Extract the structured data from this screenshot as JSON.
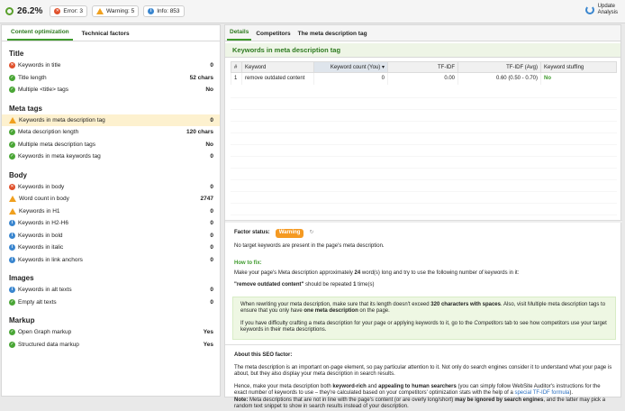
{
  "topbar": {
    "score": "26.2%",
    "error": "Error: 3",
    "warning": "Warning: 5",
    "info": "Info: 853",
    "update_line1": "Update",
    "update_line2": "Analysis"
  },
  "left": {
    "tabs": [
      "Content optimization",
      "Technical factors"
    ],
    "sections": [
      {
        "title": "Title",
        "items": [
          {
            "label": "Keywords in title",
            "value": "0",
            "status": "error"
          },
          {
            "label": "Title length",
            "value": "52 chars",
            "status": "ok"
          },
          {
            "label": "Multiple <title> tags",
            "value": "No",
            "status": "ok"
          }
        ]
      },
      {
        "title": "Meta tags",
        "items": [
          {
            "label": "Keywords in meta description tag",
            "value": "0",
            "status": "warning",
            "selected": true
          },
          {
            "label": "Meta description length",
            "value": "120 chars",
            "status": "ok"
          },
          {
            "label": "Multiple meta description tags",
            "value": "No",
            "status": "ok"
          },
          {
            "label": "Keywords in meta keywords tag",
            "value": "0",
            "status": "ok"
          }
        ]
      },
      {
        "title": "Body",
        "items": [
          {
            "label": "Keywords in body",
            "value": "0",
            "status": "error"
          },
          {
            "label": "Word count in body",
            "value": "2747",
            "status": "warning"
          },
          {
            "label": "Keywords in H1",
            "value": "0",
            "status": "warning"
          },
          {
            "label": "Keywords in H2-H6",
            "value": "0",
            "status": "info"
          },
          {
            "label": "Keywords in bold",
            "value": "0",
            "status": "info"
          },
          {
            "label": "Keywords in italic",
            "value": "0",
            "status": "info"
          },
          {
            "label": "Keywords in link anchors",
            "value": "0",
            "status": "info"
          }
        ]
      },
      {
        "title": "Images",
        "items": [
          {
            "label": "Keywords in alt texts",
            "value": "0",
            "status": "info"
          },
          {
            "label": "Empty alt texts",
            "value": "0",
            "status": "ok"
          }
        ]
      },
      {
        "title": "Markup",
        "items": [
          {
            "label": "Open Graph markup",
            "value": "Yes",
            "status": "ok"
          },
          {
            "label": "Structured data markup",
            "value": "Yes",
            "status": "ok"
          }
        ]
      }
    ]
  },
  "right": {
    "tabs": [
      "Details",
      "Competitors",
      "The meta description tag"
    ],
    "heading": "Keywords in meta description tag",
    "columns": [
      "#",
      "Keyword",
      "Keyword count (You)",
      "TF-IDF",
      "TF-IDF (Avg)",
      "Keyword stuffing"
    ],
    "rows": [
      [
        "1",
        "remove outdated content",
        "0",
        "0.00",
        "0.60 (0.50 - 0.70)",
        "No"
      ]
    ],
    "factor_label": "Factor status:",
    "factor_value": "Warning",
    "factor_text": "No target keywords are present in the page's meta description.",
    "howto_title": "How to fix:",
    "howto_line1_a": "Make your page's Meta description approximately ",
    "howto_line1_b": "24",
    "howto_line1_c": " word(s) long and try to use the following number of keywords in it:",
    "howto_kw_a": "\"remove outdated content\"",
    "howto_kw_b": " should be repeated ",
    "howto_kw_c": "1",
    "howto_kw_d": " time(s)",
    "tip1_a": "When rewriting your meta description, make sure that its length doesn't exceed ",
    "tip1_b": "320 characters with spaces",
    "tip1_c": ". Also, visit Multiple meta description tags to ensure that you only have ",
    "tip1_d": "one meta description",
    "tip1_e": " on the page.",
    "tip2_a": "If you have difficulty crafting a meta description for your page or applying keywords to it, go to the ",
    "tip2_b": "Competitors",
    "tip2_c": " tab to see how competitors use your target keywords in their meta descriptions.",
    "about_title": "About this SEO factor:",
    "about_p1": "The meta description is an important on-page element, so pay particular attention to it. Not only do search engines consider it to understand what your page is about, but they also display your meta description in search results.",
    "about_p2_a": "Hence, make your meta description both ",
    "about_p2_b": "keyword-rich",
    "about_p2_c": " and ",
    "about_p2_d": "appealing to human searchers",
    "about_p2_e": " (you can simply follow WebSite Auditor's instructions for the exact number of keywords to use – they're calculated based on your competitors' optimization stats with the help of a ",
    "about_p2_link": "special TF-IDF formula",
    "about_p2_f": ").",
    "about_note_a": "Note:",
    "about_note_b": " Meta descriptions that are not in line with the page's content (or are overly long/short) ",
    "about_note_c": "may be ignored by search engines",
    "about_note_d": ", and the latter may pick a random text snippet to show in search results instead of your description."
  }
}
